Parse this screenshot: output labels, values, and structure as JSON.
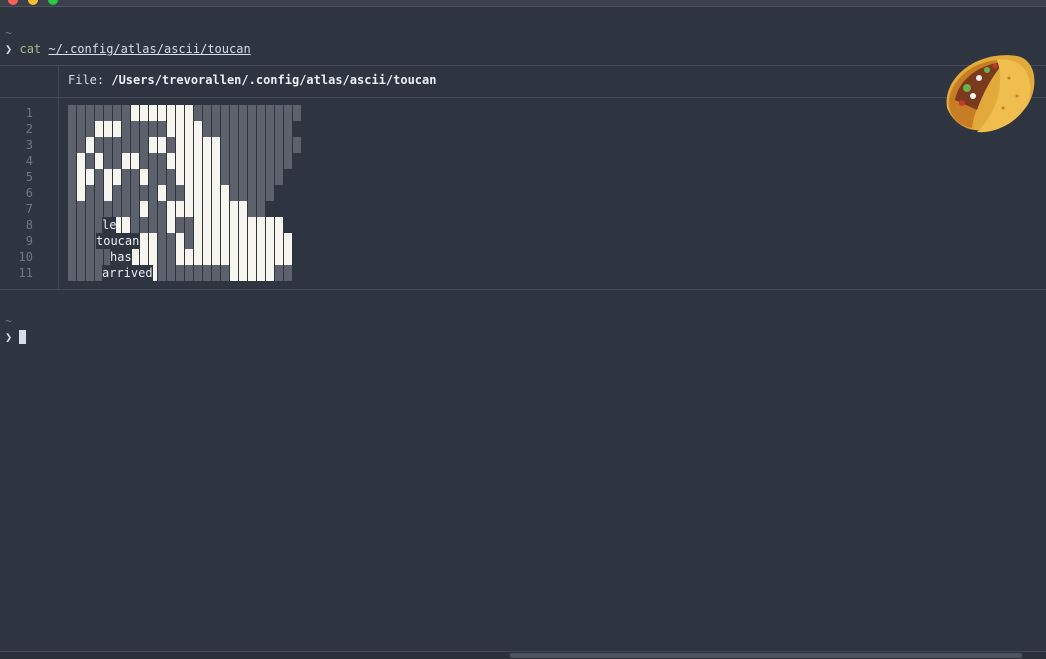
{
  "window": {
    "title": ""
  },
  "terminal": {
    "tilde": "~",
    "prompt": "❯",
    "command": "cat",
    "command_arg": "~/.config/atlas/ascii/toucan",
    "file_header_label": "File:",
    "file_header_path": "/Users/trevorallen/.config/atlas/ascii/toucan",
    "line_numbers": [
      "1",
      "2",
      "3",
      "4",
      "5",
      "6",
      "7",
      "8",
      "9",
      "10",
      "11"
    ],
    "art_text": [
      "le",
      "toucan",
      "has",
      "arrived"
    ],
    "second_tilde": "~",
    "second_prompt": "❯"
  },
  "decorations": {
    "taco_icon": "taco-emoji"
  },
  "colors": {
    "background": "#2e3440",
    "command": "#a3be8c",
    "muted": "#6f7787"
  }
}
